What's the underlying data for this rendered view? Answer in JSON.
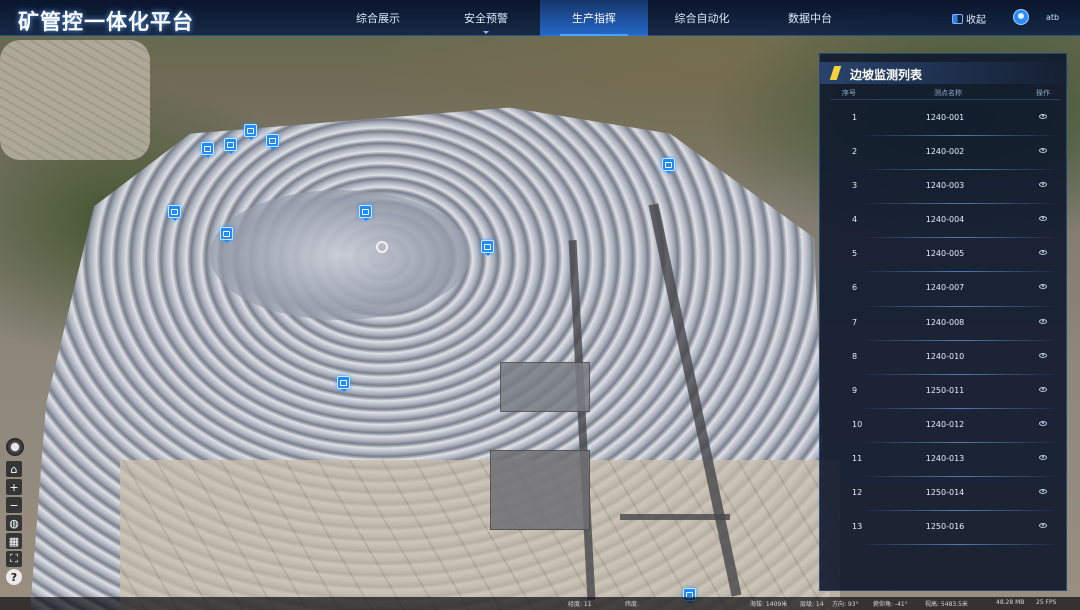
{
  "header": {
    "app_title": "矿管控一体化平台",
    "nav_items": [
      {
        "label": "综合展示",
        "active": false
      },
      {
        "label": "安全预警",
        "active": false
      },
      {
        "label": "生产指挥",
        "active": true
      },
      {
        "label": "综合自动化",
        "active": false
      },
      {
        "label": "数据中台",
        "active": false
      }
    ],
    "collapse_label": "收起",
    "user_name": "atb"
  },
  "panel": {
    "title": "边坡监测列表",
    "columns": {
      "index": "序号",
      "name": "测点名称",
      "action": "操作"
    },
    "rows": [
      {
        "index": "1",
        "name": "1240-001"
      },
      {
        "index": "2",
        "name": "1240-002"
      },
      {
        "index": "3",
        "name": "1240-003"
      },
      {
        "index": "4",
        "name": "1240-004"
      },
      {
        "index": "5",
        "name": "1240-005"
      },
      {
        "index": "6",
        "name": "1240-007"
      },
      {
        "index": "7",
        "name": "1240-008"
      },
      {
        "index": "8",
        "name": "1240-010"
      },
      {
        "index": "9",
        "name": "1250-011"
      },
      {
        "index": "10",
        "name": "1240-012"
      },
      {
        "index": "11",
        "name": "1240-013"
      },
      {
        "index": "12",
        "name": "1250-014"
      },
      {
        "index": "13",
        "name": "1250-016"
      }
    ],
    "row_action_icon": "eye-icon"
  },
  "toolbar": {
    "items": [
      "compass-icon",
      "home-icon",
      "zoom-in-icon",
      "zoom-out-icon",
      "globe-icon",
      "layers-icon",
      "fullscreen-icon",
      "help-icon"
    ],
    "zoom_in_label": "+",
    "zoom_out_label": "−",
    "help_label": "?"
  },
  "statusbar": {
    "longitude": "经度: 11",
    "latitude": "纬度:",
    "altitude": "海拔: 1409米",
    "level": "层级: 14",
    "heading": "方向: 93°",
    "pitch": "俯仰角: -41°",
    "view_height": "视高: 5483.5米",
    "memory": "48.28 MB",
    "fps": "25 FPS"
  },
  "colors": {
    "accent": "#2a8cff",
    "header_bg": "#061230",
    "panel_bg": "#0e182c",
    "title_icon": "#f2d13a"
  }
}
